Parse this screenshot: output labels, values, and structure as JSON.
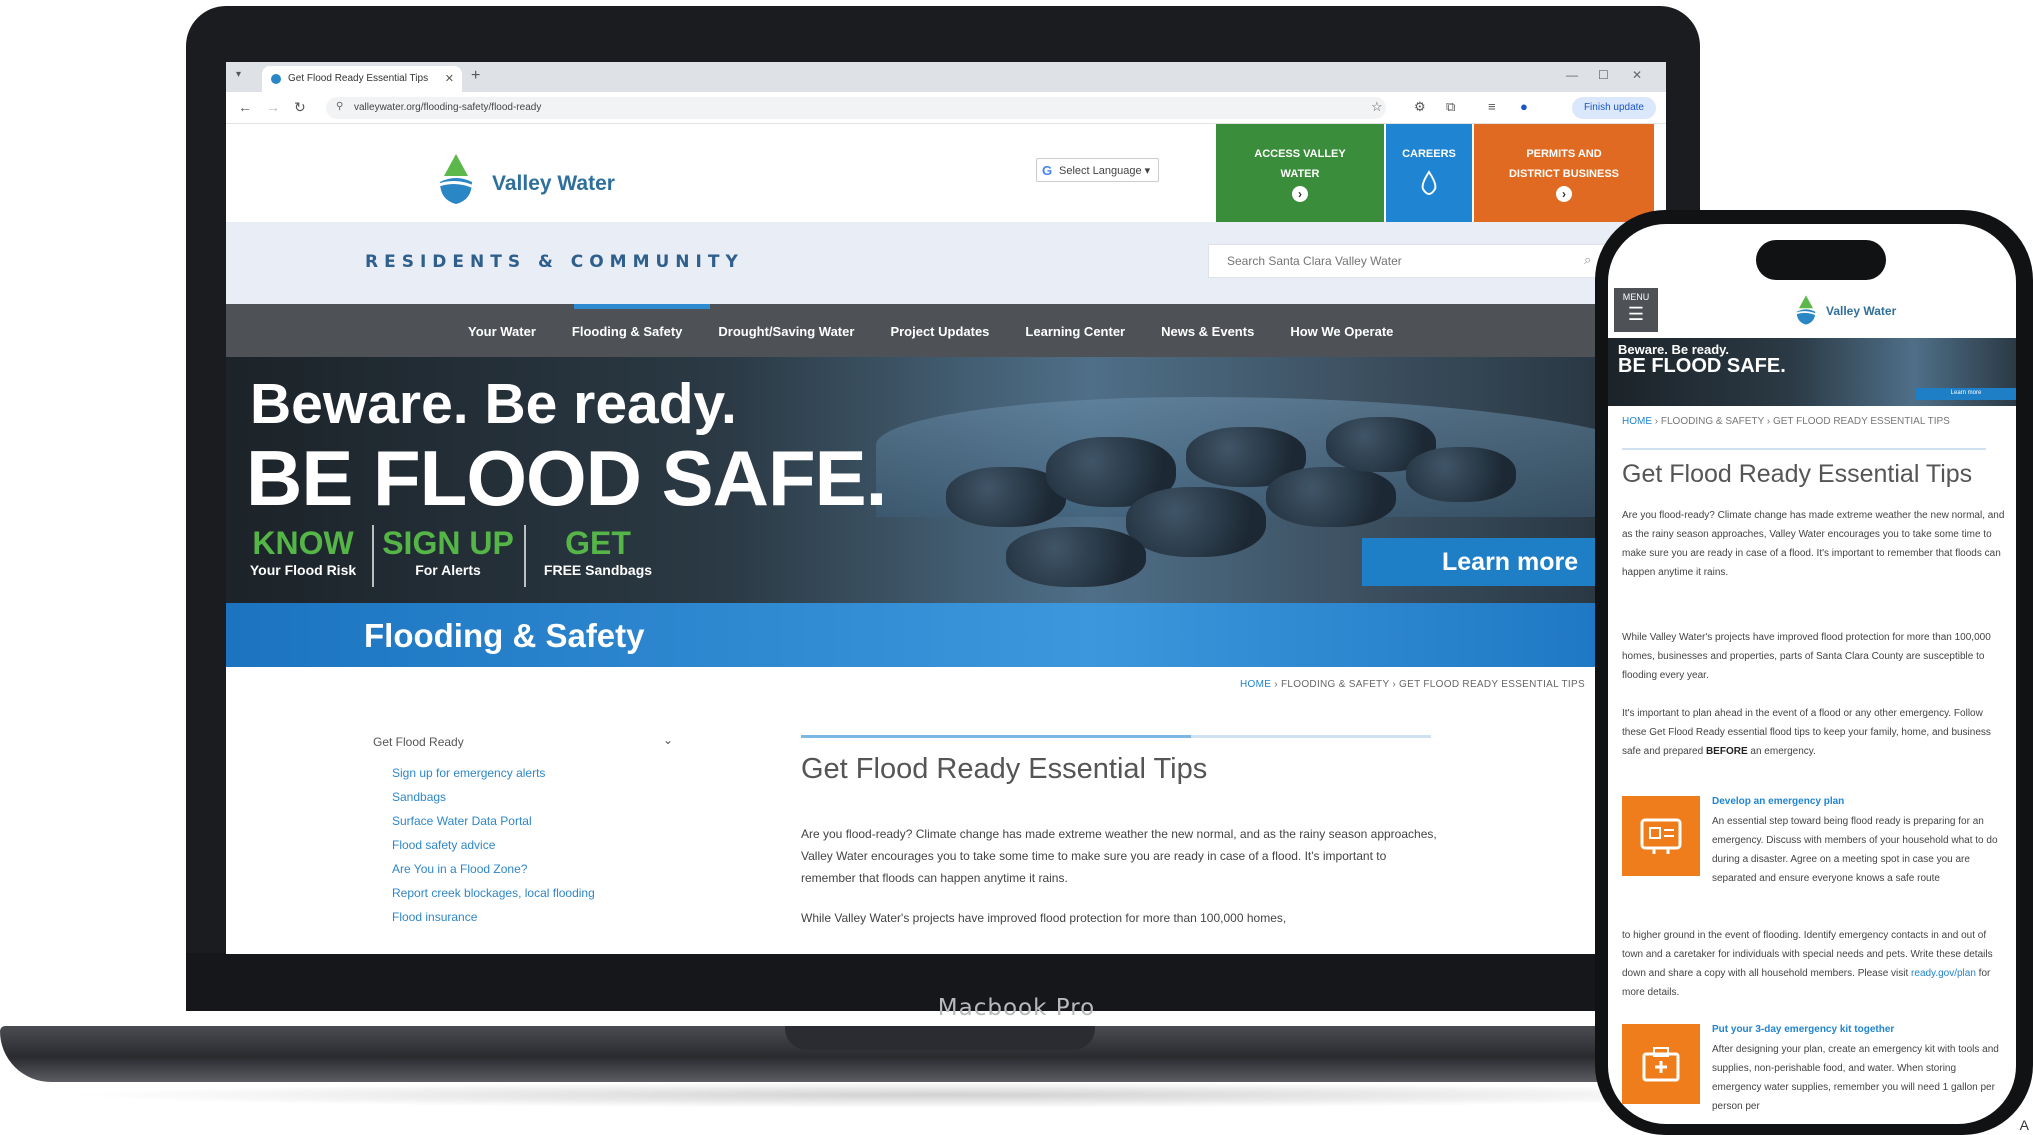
{
  "browser": {
    "tab_title": "Get Flood Ready Essential Tips",
    "url": "valleywater.org/flooding-safety/flood-ready",
    "finish_update": "Finish update"
  },
  "site": {
    "logo_text": "Valley Water",
    "select_language": "Select Language",
    "header_buttons": [
      {
        "label_1": "ACCESS VALLEY",
        "label_2": "WATER",
        "color": "#3a8d3a"
      },
      {
        "label_1": "CAREERS",
        "label_2": "",
        "color": "#1f84d1"
      },
      {
        "label_1": "PERMITS AND",
        "label_2": "DISTRICT BUSINESS",
        "color": "#e06a21"
      }
    ],
    "section_heading": "RESIDENTS & COMMUNITY",
    "search_placeholder": "Search Santa Clara Valley Water",
    "nav": [
      "Your Water",
      "Flooding & Safety",
      "Drought/Saving Water",
      "Project Updates",
      "Learning Center",
      "News & Events",
      "How We Operate"
    ],
    "active_nav": "Flooding & Safety"
  },
  "hero": {
    "line1": "Beware. Be ready.",
    "line2": "BE FLOOD SAFE.",
    "ctas": [
      {
        "big": "KNOW",
        "small": "Your Flood Risk"
      },
      {
        "big": "SIGN UP",
        "small": "For Alerts"
      },
      {
        "big": "GET",
        "small": "FREE Sandbags"
      }
    ],
    "learn_more": "Learn more",
    "accent": "#55b647"
  },
  "section": {
    "title": "Flooding & Safety"
  },
  "breadcrumb": {
    "home": "HOME",
    "rest": " › FLOODING & SAFETY › GET FLOOD READY ESSENTIAL TIPS"
  },
  "sidebar": {
    "heading": "Get Flood Ready",
    "links": [
      "Sign up for emergency alerts",
      "Sandbags",
      "Surface Water Data Portal",
      "Flood safety advice",
      "Are You in a Flood Zone?",
      "Report creek blockages, local flooding",
      "Flood insurance"
    ]
  },
  "page": {
    "title": "Get Flood Ready Essential Tips",
    "intro": "Are you flood-ready? Climate change has made extreme weather the new normal, and as the rainy season approaches, Valley Water encourages you to take some time to make sure you are ready in case of a flood. It's important to remember that floods can happen anytime it rains.",
    "para2": "While Valley Water's projects have improved flood protection for more than 100,000 homes,"
  },
  "device_label": "Macbook Pro",
  "phone": {
    "menu_label": "MENU",
    "logo_text": "Valley Water",
    "hero_line1": "Beware. Be ready.",
    "hero_line2": "BE FLOOD SAFE.",
    "hero_learn_more": "Learn more",
    "breadcrumb_home": "HOME",
    "breadcrumb_rest": " › FLOODING & SAFETY › GET FLOOD READY ESSENTIAL TIPS",
    "title": "Get Flood Ready Essential Tips",
    "p1": "Are you flood-ready? Climate change has made extreme weather the new normal, and as the rainy season approaches, Valley Water encourages you to take some time to make sure you are ready in case of a flood. It's important to remember that floods can happen anytime it rains.",
    "p2": "While Valley Water's projects have improved flood protection for more than 100,000 homes, businesses and properties, parts of Santa Clara County are susceptible to flooding every year.",
    "p3_a": "It's important to plan ahead in the event of a flood or any other emergency. Follow these Get Flood Ready essential flood tips to keep your family, home, and business safe and prepared ",
    "p3_b": "BEFORE",
    "p3_c": " an emergency.",
    "step1_title": "Develop an emergency plan",
    "step1_body": "An essential step toward being flood ready is preparing for an emergency. Discuss with members of your household what to do during a disaster. Agree on a meeting spot in case you are separated and ensure everyone knows a safe route",
    "step1_more_a": "to higher ground in the event of flooding. Identify emergency contacts in and out of town and a caretaker for individuals with special needs and pets. Write these details down and share a copy with all household members. Please visit ",
    "step1_link": "ready.gov/plan",
    "step1_more_b": " for more details.",
    "step2_title": "Put your 3-day emergency kit together",
    "step2_body": "After designing your plan, create an emergency kit with tools and supplies, non-perishable food, and water. When storing emergency water supplies, remember you will need 1 gallon per person per"
  },
  "corner_mark": "A"
}
